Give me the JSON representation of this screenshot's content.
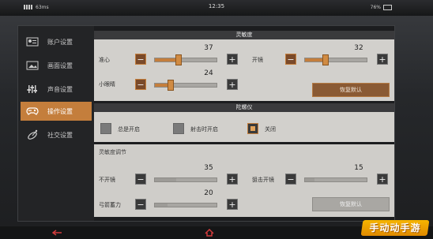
{
  "status_bar": {
    "network_speed": "63ms",
    "time": "12:35",
    "percent": "76%"
  },
  "sidebar": {
    "items": [
      {
        "label": "账户设置",
        "icon": "user-card-icon",
        "active": false
      },
      {
        "label": "画面设置",
        "icon": "image-icon",
        "active": false
      },
      {
        "label": "声音设置",
        "icon": "equalizer-icon",
        "active": false
      },
      {
        "label": "操作设置",
        "icon": "gamepad-gear-icon",
        "active": true
      },
      {
        "label": "社交设置",
        "icon": "satellite-icon",
        "active": false
      }
    ]
  },
  "sensitivity": {
    "title": "灵敏度",
    "rows": [
      {
        "label": "准心",
        "value": "37",
        "level": 0.37
      },
      {
        "label": "开镜",
        "value": "32",
        "level": 0.32
      },
      {
        "label": "小眼睛",
        "value": "24",
        "level": 0.24
      }
    ],
    "reset_label": "恢复默认"
  },
  "gyroscope": {
    "title": "陀螺仪",
    "options": [
      {
        "label": "总是开启",
        "checked": false
      },
      {
        "label": "射击时开启",
        "checked": false
      },
      {
        "label": "关闭",
        "checked": true
      }
    ]
  },
  "gyro_sensitivity": {
    "title": "灵敏度调节",
    "rows": [
      {
        "label": "不开镜",
        "value": "35",
        "level": 0.35
      },
      {
        "label": "狙击开镜",
        "value": "15",
        "level": 0.15
      },
      {
        "label": "弓箭蓄力",
        "value": "20",
        "level": 0.2
      }
    ],
    "reset_label": "恢复默认"
  },
  "watermark": "手动动手游",
  "colors": {
    "accent": "#c47e3c",
    "panel": "#d2d0cc",
    "header": "#3a3a3c"
  }
}
